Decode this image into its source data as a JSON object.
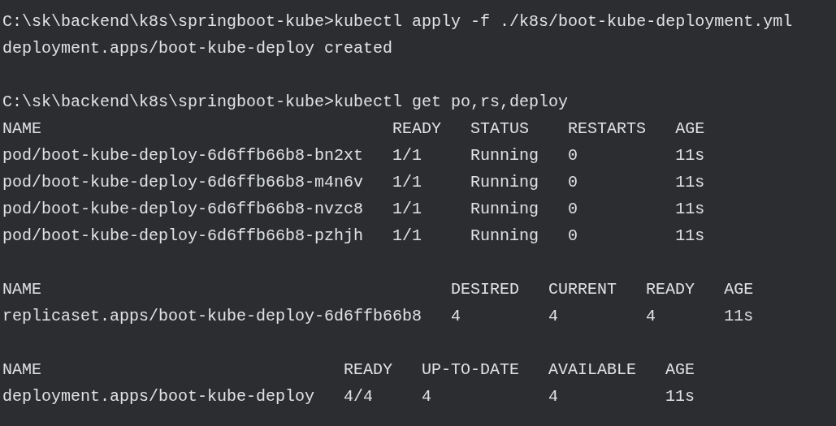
{
  "sections": [
    {
      "lines": [
        {
          "kind": "command",
          "prompt": "C:\\sk\\backend\\k8s\\springboot-kube>",
          "command": "kubectl apply -f ./k8s/boot-kube-deployment.yml"
        },
        {
          "kind": "output",
          "text": "deployment.apps/boot-kube-deploy created"
        }
      ]
    },
    {
      "lines": [
        {
          "kind": "command",
          "prompt": "C:\\sk\\backend\\k8s\\springboot-kube>",
          "command": "kubectl get po,rs,deploy"
        },
        {
          "kind": "table",
          "columns": [
            "NAME",
            "READY",
            "STATUS",
            "RESTARTS",
            "AGE"
          ],
          "rows": [
            [
              "pod/boot-kube-deploy-6d6ffb66b8-bn2xt",
              "1/1",
              "Running",
              "0",
              "11s"
            ],
            [
              "pod/boot-kube-deploy-6d6ffb66b8-m4n6v",
              "1/1",
              "Running",
              "0",
              "11s"
            ],
            [
              "pod/boot-kube-deploy-6d6ffb66b8-nvzc8",
              "1/1",
              "Running",
              "0",
              "11s"
            ],
            [
              "pod/boot-kube-deploy-6d6ffb66b8-pzhjh",
              "1/1",
              "Running",
              "0",
              "11s"
            ]
          ]
        }
      ]
    },
    {
      "lines": [
        {
          "kind": "table",
          "columns": [
            "NAME",
            "DESIRED",
            "CURRENT",
            "READY",
            "AGE"
          ],
          "rows": [
            [
              "replicaset.apps/boot-kube-deploy-6d6ffb66b8",
              "4",
              "4",
              "4",
              "11s"
            ]
          ]
        }
      ]
    },
    {
      "lines": [
        {
          "kind": "table",
          "columns": [
            "NAME",
            "READY",
            "UP-TO-DATE",
            "AVAILABLE",
            "AGE"
          ],
          "rows": [
            [
              "deployment.apps/boot-kube-deploy",
              "4/4",
              "4",
              "4",
              "11s"
            ]
          ]
        }
      ]
    }
  ]
}
